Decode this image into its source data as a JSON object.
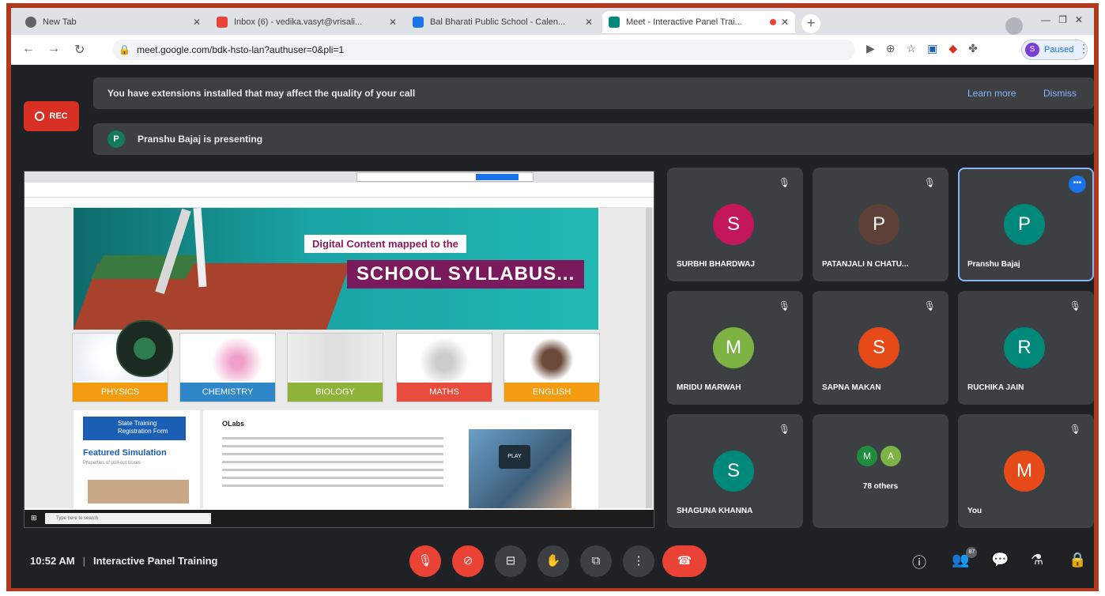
{
  "browser": {
    "tabs": [
      {
        "title": "New Tab",
        "fav_color": "#5f6368"
      },
      {
        "title": "Inbox (6) - vedika.vasyt@vrisali...",
        "fav_color": "#ea4335"
      },
      {
        "title": "Bal Bharati Public School - Calen...",
        "fav_color": "#1a73e8"
      },
      {
        "title": "Meet - Interactive Panel Trai...",
        "fav_color": "#00897b"
      }
    ],
    "url": "meet.google.com/bdk-hsto-lan?authuser=0&pli=1",
    "profile_label": "Paused",
    "profile_initial": "S"
  },
  "meet": {
    "rec_label": "REC",
    "banner_text": "You have extensions installed that may affect the quality of your call",
    "banner_learn_more": "Learn more",
    "banner_dismiss": "Dismiss",
    "presenting_initial": "P",
    "presenting_text": "Pranshu Bajaj is presenting",
    "shared_screen": {
      "hero_line1": "Digital Content mapped to the",
      "hero_line2": "SCHOOL SYLLABUS...",
      "subjects": [
        {
          "label": "PHYSICS",
          "color": "#f39c12"
        },
        {
          "label": "CHEMISTRY",
          "color": "#2f86c8"
        },
        {
          "label": "BIOLOGY",
          "color": "#8db33a"
        },
        {
          "label": "MATHS",
          "color": "#e74c3c"
        },
        {
          "label": "ENGLISH",
          "color": "#f39c12"
        }
      ],
      "training_text": "State Training Registration Form",
      "featured_title": "Featured Simulation",
      "featured_desc": "Properties of pull-out boxes",
      "olabs_title": "OLabs",
      "play_label": "PLAY",
      "taskbar_search": "Type here to search"
    },
    "participants": [
      {
        "initial": "S",
        "name": "SURBHI BHARDWAJ",
        "color": "#c2185b"
      },
      {
        "initial": "P",
        "name": "PATANJALI N CHATU...",
        "color": "#5d4037"
      },
      {
        "initial": "P",
        "name": "Pranshu Bajaj",
        "color": "#00897b"
      },
      {
        "initial": "M",
        "name": "MRIDU MARWAH",
        "color": "#7cb342"
      },
      {
        "initial": "S",
        "name": "SAPNA MAKAN",
        "color": "#e64a19"
      },
      {
        "initial": "R",
        "name": "RUCHIKA JAIN",
        "color": "#00897b"
      },
      {
        "initial": "S",
        "name": "SHAGUNA KHANNA",
        "color": "#00897b"
      },
      {
        "initial": "",
        "name": "78 others",
        "color": ""
      },
      {
        "initial": "M",
        "name": "You",
        "color": "#e64a19"
      }
    ],
    "others_initials": [
      "M",
      "A"
    ],
    "time": "10:52 AM",
    "meeting_title": "Interactive Panel Training",
    "people_count": "87"
  }
}
